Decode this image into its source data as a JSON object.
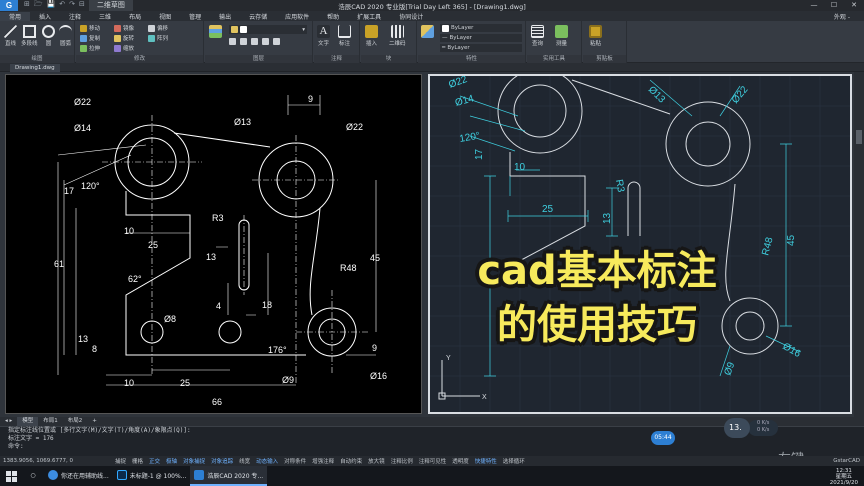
{
  "app": {
    "logo": "G",
    "title": "浩辰CAD 2020 专业版[Trial Day Left 365] - [Drawing1.dwg]",
    "quick_access": [
      "⊞",
      "🗁",
      "💾",
      "↶",
      "↷",
      "⊟"
    ],
    "file_placeholder": "二维草图",
    "outside": "外观 -"
  },
  "menu": [
    "常用",
    "插入",
    "注释",
    "三维",
    "布局",
    "视图",
    "管理",
    "输出",
    "云存储",
    "应用软件",
    "帮助",
    "扩展工具",
    "协同设计"
  ],
  "ribbon": {
    "groups": [
      {
        "label": "绘图",
        "tools": [
          "直线",
          "多段线",
          "圆",
          "圆弧"
        ]
      },
      {
        "label": "修改",
        "tools": [
          "移动",
          "复制",
          "旋转",
          "拉伸",
          "偏移",
          "镜像",
          "缩放",
          "阵列"
        ]
      },
      {
        "label": "图层",
        "tools": []
      },
      {
        "label": "注释",
        "tools": [
          "文字",
          "标注"
        ]
      },
      {
        "label": "块",
        "tools": [
          "插入",
          "二维码"
        ]
      },
      {
        "label": "特性",
        "tools": [
          "ByLayer",
          "ByLayer",
          "ByLayer"
        ]
      },
      {
        "label": "实用工具",
        "tools": [
          "查询",
          "测量"
        ]
      },
      {
        "label": "剪贴板",
        "tools": [
          "粘贴"
        ]
      }
    ]
  },
  "doc_tab": "Drawing1.dwg",
  "drawing": {
    "left_labels": [
      "Ø22",
      "Ø14",
      "120°",
      "17",
      "61",
      "10",
      "25",
      "62°",
      "13",
      "8",
      "Ø8",
      "10",
      "25",
      "66",
      "Ø13",
      "9",
      "Ø22",
      "R3",
      "13",
      "4",
      "18",
      "R48",
      "45",
      "176°",
      "Ø9",
      "Ø16",
      "9"
    ],
    "right_labels": [
      "Ø22",
      "Ø14",
      "120°",
      "17",
      "10",
      "25",
      "R3",
      "13",
      "61",
      "Ø13",
      "Ø22",
      "R48",
      "45",
      "Ø16",
      "Ø9"
    ]
  },
  "layout_tabs": [
    "模型",
    "布局1",
    "布局2",
    "+"
  ],
  "command": {
    "line1": "指定标注线位置或 [多行文字(M)/文字(T)/角度(A)/象限点(Q)]:",
    "line2": "标注文字 = 176",
    "line3": "命令:"
  },
  "status": {
    "coords": "1383.9056, 1069.6777, 0",
    "toggles": [
      "捕捉",
      "栅格",
      "正交",
      "极轴",
      "对象捕捉",
      "对象追踪",
      "线宽",
      "动态输入",
      "对称条件",
      "增强注释",
      "自动约束",
      "放大镜",
      "注释比例",
      "注释可见性",
      "透明度",
      "快捷特性",
      "选择循环"
    ],
    "right_text": "GstarCAD"
  },
  "overlay": {
    "line1": "cad基本标注",
    "line2": "的使用技巧"
  },
  "recorder": {
    "timer": "05:44",
    "badge": "13.",
    "pill1": "0 K/s",
    "pill2": "0 K/s"
  },
  "watermark": "左键",
  "taskbar": {
    "items": [
      "你还在用辅助线...",
      "未标题-1 @ 100%...",
      "浩辰CAD 2020 专..."
    ],
    "time": "12:31",
    "weekday": "星期五",
    "date": "2021/9/20"
  }
}
